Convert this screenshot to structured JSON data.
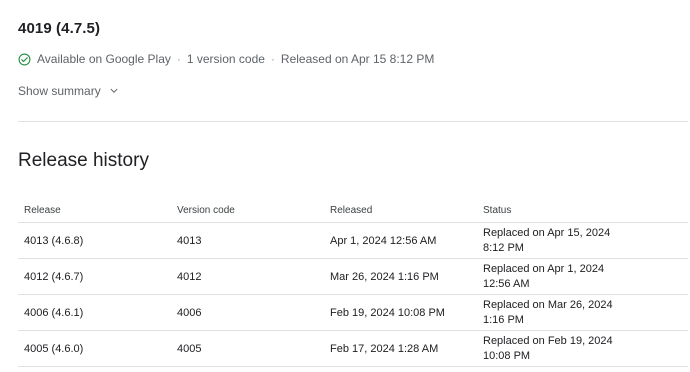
{
  "release": {
    "title": "4019 (4.7.5)",
    "availability": "Available on Google Play",
    "version_codes": "1 version code",
    "released": "Released on Apr 15 8:12 PM",
    "separator": "·",
    "summary_toggle": "Show summary"
  },
  "history": {
    "title": "Release history",
    "columns": [
      "Release",
      "Version code",
      "Released",
      "Status"
    ],
    "rows": [
      {
        "release": "4013 (4.6.8)",
        "version_code": "4013",
        "released": "Apr 1, 2024 12:56 AM",
        "status": "Replaced on Apr 15, 2024 8:12 PM"
      },
      {
        "release": "4012 (4.6.7)",
        "version_code": "4012",
        "released": "Mar 26, 2024 1:16 PM",
        "status": "Replaced on Apr 1, 2024 12:56 AM"
      },
      {
        "release": "4006 (4.6.1)",
        "version_code": "4006",
        "released": "Feb 19, 2024 10:08 PM",
        "status": "Replaced on Mar 26, 2024 1:16 PM"
      },
      {
        "release": "4005 (4.6.0)",
        "version_code": "4005",
        "released": "Feb 17, 2024 1:28 AM",
        "status": "Replaced on Feb 19, 2024 10:08 PM"
      }
    ]
  },
  "colors": {
    "available_green": "#1e8e3e",
    "text_secondary": "#5f6368",
    "divider": "#e0e0e0"
  },
  "icons": {
    "available": "check-circle-icon",
    "summary": "chevron-down-icon"
  }
}
